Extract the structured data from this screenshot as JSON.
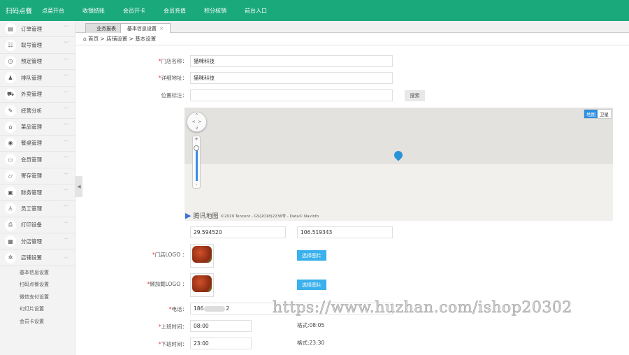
{
  "topbar": {
    "brand": "扫码点餐",
    "nav": [
      "点菜开台",
      "收银结账",
      "会员开卡",
      "会员充值",
      "积分核销",
      "前台入口"
    ]
  },
  "sidebar": {
    "items": [
      {
        "label": "订单管理",
        "icon": "clipboard-icon",
        "glyph": "▤"
      },
      {
        "label": "取号管理",
        "icon": "ticket-icon",
        "glyph": "☷"
      },
      {
        "label": "预定管理",
        "icon": "clock-icon",
        "glyph": "◷"
      },
      {
        "label": "排队管理",
        "icon": "queue-icon",
        "glyph": "♟"
      },
      {
        "label": "外卖管理",
        "icon": "delivery-icon",
        "glyph": "⛟"
      },
      {
        "label": "经营分析",
        "icon": "chart-icon",
        "glyph": "✎"
      },
      {
        "label": "菜品管理",
        "icon": "dish-icon",
        "glyph": "⌂"
      },
      {
        "label": "餐桌管理",
        "icon": "table-icon",
        "glyph": "◉"
      },
      {
        "label": "会员管理",
        "icon": "card-icon",
        "glyph": "▭"
      },
      {
        "label": "寄存管理",
        "icon": "folder-icon",
        "glyph": "▱"
      },
      {
        "label": "财务管理",
        "icon": "wallet-icon",
        "glyph": "▣"
      },
      {
        "label": "员工管理",
        "icon": "user-icon",
        "glyph": "♙"
      },
      {
        "label": "打印设备",
        "icon": "printer-icon",
        "glyph": "⎙"
      },
      {
        "label": "分店管理",
        "icon": "store-icon",
        "glyph": "▦"
      },
      {
        "label": "店铺设置",
        "icon": "gear-icon",
        "glyph": "✲"
      }
    ],
    "sub_items": [
      "基本信息设置",
      "扫码点餐设置",
      "微信支付设置",
      "幻灯片设置",
      "会员卡设置"
    ]
  },
  "tabs": [
    {
      "label": "业务报表"
    },
    {
      "label": "基本信息设置",
      "close": "×"
    }
  ],
  "breadcrumb": {
    "home": "首页",
    "sep": ">",
    "items": [
      "店铺设置",
      "基本设置"
    ]
  },
  "form": {
    "store_name": {
      "label": "门店名称：",
      "value": "猫咪科技"
    },
    "address": {
      "label": "详细地址：",
      "value": "猫咪科技"
    },
    "location": {
      "label": "位置标注：",
      "value": "",
      "search": "搜索"
    },
    "map": {
      "type_map": "地图",
      "type_sat": "卫星",
      "brand": "腾讯地图",
      "copyright": "©2019 Tencent - GS(2018)2236号 - Data© NavInfo"
    },
    "lat": "29.594520",
    "lng": "106.519343",
    "logo": {
      "label": "门店LOGO ：",
      "button": "选择图片"
    },
    "loading_logo": {
      "label": "懒加载LOGO ：",
      "button": "选择图片"
    },
    "phone": {
      "label": "电话：",
      "value_prefix": "186",
      "value_suffix": "2"
    },
    "open_time": {
      "label": "上班时间：",
      "value": "08:00",
      "hint": "格式:08:05"
    },
    "close_time": {
      "label": "下班时间：",
      "value": "23:00",
      "hint": "格式:23:30"
    },
    "required_mark": "*"
  },
  "watermark": "https://www.huzhan.com/ishop20302"
}
